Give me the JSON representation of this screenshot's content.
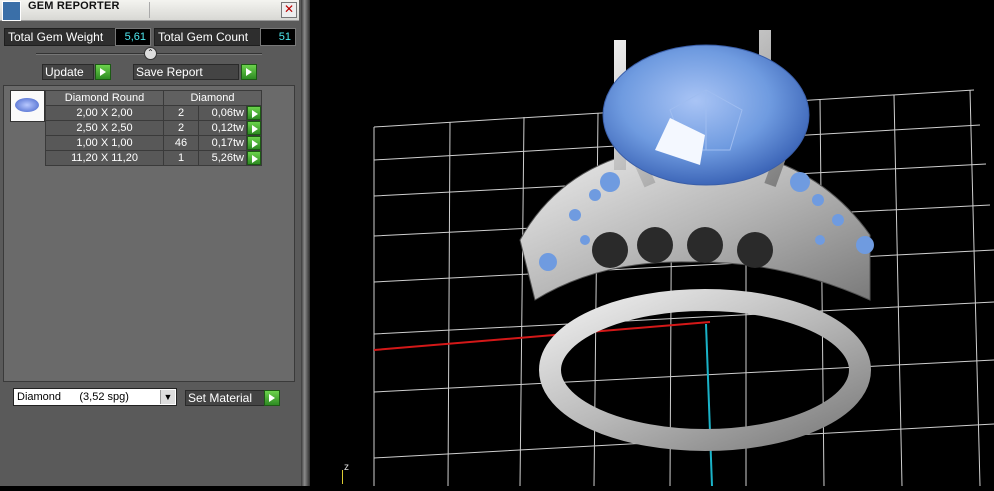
{
  "window": {
    "title": "GEM REPORTER",
    "close_glyph": "✕"
  },
  "stats": {
    "total_weight_label": "Total Gem Weight",
    "total_weight_value": "5,61",
    "total_count_label": "Total Gem Count",
    "total_count_value": "51"
  },
  "actions": {
    "update_label": "Update",
    "save_report_label": "Save Report"
  },
  "table": {
    "headers": [
      "Diamond Round",
      "Diamond"
    ],
    "rows": [
      {
        "size": "2,00 X 2,00",
        "count": "2",
        "weight": "0,06tw"
      },
      {
        "size": "2,50 X 2,50",
        "count": "2",
        "weight": "0,12tw"
      },
      {
        "size": "1,00 X 1,00",
        "count": "46",
        "weight": "0,17tw"
      },
      {
        "size": "11,20 X 11,20",
        "count": "1",
        "weight": "5,26tw"
      }
    ]
  },
  "material": {
    "selected": "Diamond      (3,52 spg)",
    "dropdown_glyph": "▼",
    "set_label": "Set Material"
  },
  "viewport": {
    "axis_label": "z"
  },
  "colors": {
    "accent_green": "#3fae2a",
    "value_cyan": "#4ee8f0",
    "gem_blue": "#6f9be0",
    "metal": "#c8c8c8"
  },
  "icons": [
    "app-icon",
    "close-icon",
    "slider-knob-icon",
    "play-arrow-icon",
    "gem-thumbnail-icon",
    "dropdown-arrow-icon"
  ]
}
